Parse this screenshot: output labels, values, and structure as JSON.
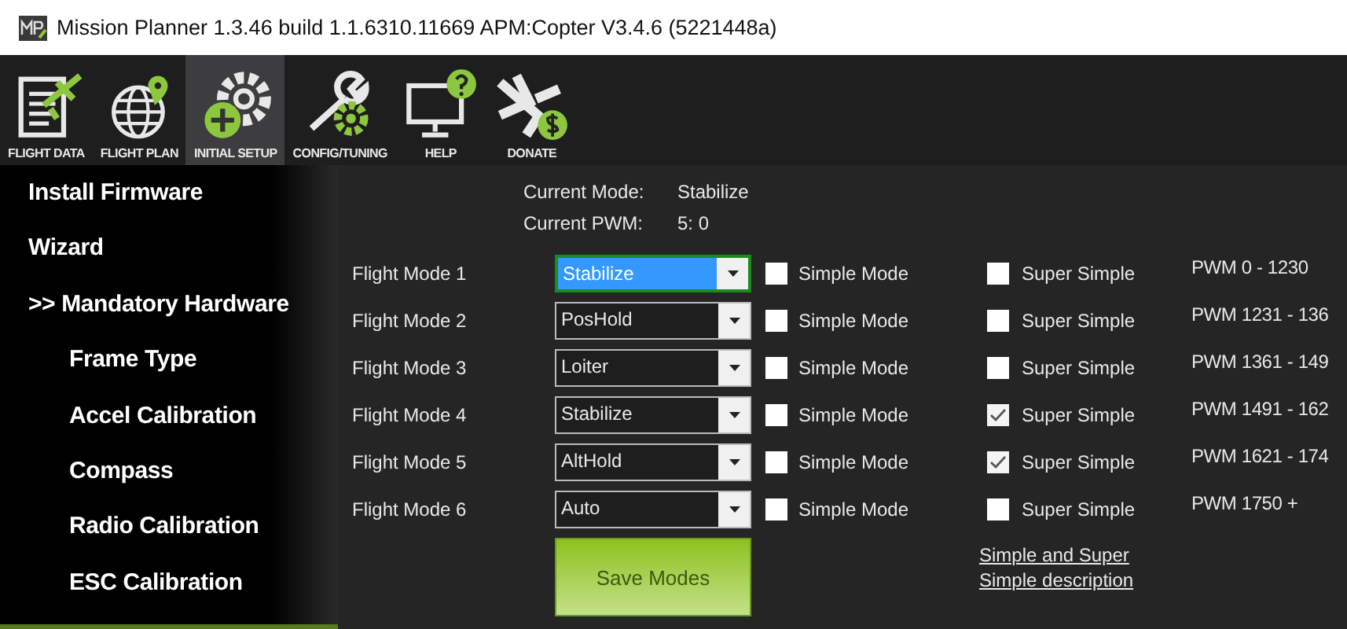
{
  "window": {
    "title": "Mission Planner 1.3.46 build 1.1.6310.11669 APM:Copter V3.4.6 (5221448a)"
  },
  "toolbar": [
    {
      "label": "FLIGHT DATA",
      "kind": "document",
      "selected": false
    },
    {
      "label": "FLIGHT PLAN",
      "kind": "globe",
      "selected": false
    },
    {
      "label": "INITIAL SETUP",
      "kind": "gear",
      "selected": true
    },
    {
      "label": "CONFIG/TUNING",
      "kind": "wrench",
      "selected": false
    },
    {
      "label": "HELP",
      "kind": "monitor",
      "selected": false
    },
    {
      "label": "DONATE",
      "kind": "plane",
      "selected": false
    }
  ],
  "sidebar": {
    "items": [
      {
        "label": "Install Firmware"
      },
      {
        "label": "Wizard"
      },
      {
        "label": ">> Mandatory Hardware",
        "expanded": true,
        "children": [
          {
            "label": "Frame Type"
          },
          {
            "label": "Accel Calibration"
          },
          {
            "label": "Compass"
          },
          {
            "label": "Radio Calibration"
          },
          {
            "label": "ESC Calibration"
          }
        ]
      }
    ]
  },
  "status": {
    "mode_label": "Current Mode:",
    "mode_value": "Stabilize",
    "pwm_label": "Current PWM:",
    "pwm_value": "5: 0"
  },
  "flight_modes": [
    {
      "label": "Flight Mode 1",
      "mode": "Stabilize",
      "focused": true,
      "simple_label": "Simple Mode",
      "simple": false,
      "super_label": "Super Simple",
      "super_simple": false,
      "pwm": "PWM 0 - 1230"
    },
    {
      "label": "Flight Mode 2",
      "mode": "PosHold",
      "focused": false,
      "simple_label": "Simple Mode",
      "simple": false,
      "super_label": "Super Simple",
      "super_simple": false,
      "pwm": "PWM 1231 - 136"
    },
    {
      "label": "Flight Mode 3",
      "mode": "Loiter",
      "focused": false,
      "simple_label": "Simple Mode",
      "simple": false,
      "super_label": "Super Simple",
      "super_simple": false,
      "pwm": "PWM 1361 - 149"
    },
    {
      "label": "Flight Mode 4",
      "mode": "Stabilize",
      "focused": false,
      "simple_label": "Simple Mode",
      "simple": false,
      "super_label": "Super Simple",
      "super_simple": true,
      "pwm": "PWM 1491 - 162"
    },
    {
      "label": "Flight Mode 5",
      "mode": "AltHold",
      "focused": false,
      "simple_label": "Simple Mode",
      "simple": false,
      "super_label": "Super Simple",
      "super_simple": true,
      "pwm": "PWM 1621 - 174"
    },
    {
      "label": "Flight Mode 6",
      "mode": "Auto",
      "focused": false,
      "simple_label": "Simple Mode",
      "simple": false,
      "super_label": "Super Simple",
      "super_simple": false,
      "pwm": "PWM 1750 +"
    }
  ],
  "save_button": "Save Modes",
  "help_link": "Simple and Super Simple description"
}
